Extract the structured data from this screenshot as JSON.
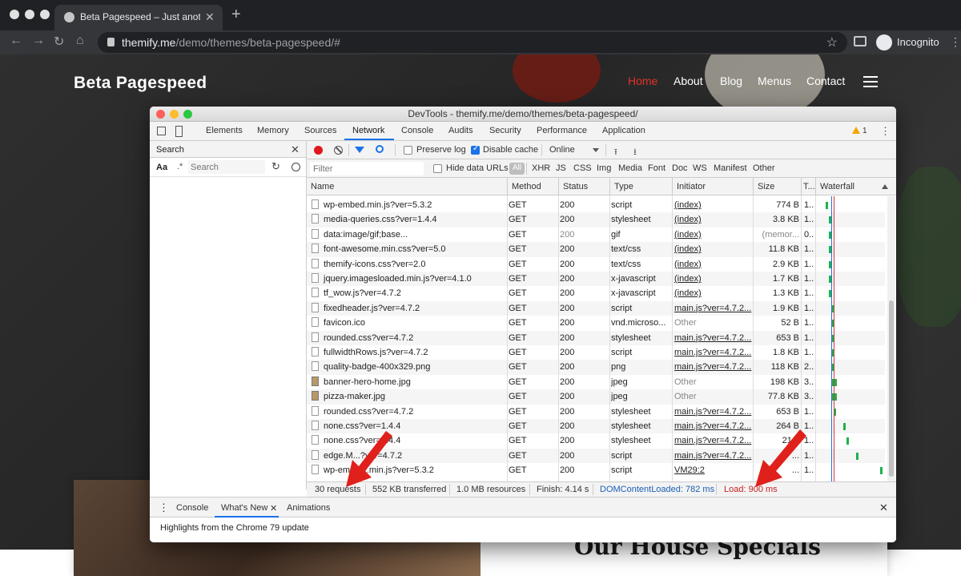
{
  "browser": {
    "tab_title": "Beta Pagespeed – Just another",
    "url_host": "themify.me",
    "url_path": "/demo/themes/beta-pagespeed/#",
    "profile_label": "Incognito"
  },
  "site": {
    "brand": "Beta Pagespeed",
    "nav": [
      "Home",
      "About",
      "Blog",
      "Menus",
      "Contact"
    ],
    "section_heading": "Our House Specials",
    "accent_color": "#e4312b"
  },
  "devtools": {
    "window_title": "DevTools - themify.me/demo/themes/beta-pagespeed/",
    "tabs": [
      "Elements",
      "Memory",
      "Sources",
      "Network",
      "Console",
      "Audits",
      "Security",
      "Performance",
      "Application"
    ],
    "active_tab": "Network",
    "warnings": "1",
    "search": {
      "title": "Search",
      "case_label": "Aa",
      "regex_label": ".*",
      "placeholder": "Search"
    },
    "toolbar": {
      "preserve_log": "Preserve log",
      "disable_cache": "Disable cache",
      "throttle": "Online"
    },
    "filter": {
      "placeholder": "Filter",
      "hide_data_urls": "Hide data URLs",
      "types": [
        "All",
        "XHR",
        "JS",
        "CSS",
        "Img",
        "Media",
        "Font",
        "Doc",
        "WS",
        "Manifest",
        "Other"
      ]
    },
    "columns": [
      "Name",
      "Method",
      "Status",
      "Type",
      "Initiator",
      "Size",
      "T...",
      "Waterfall"
    ],
    "rows": [
      {
        "name": "wp-embed.min.js?ver=5.3.2",
        "method": "GET",
        "status": "200",
        "type": "script",
        "initiator": "(index)",
        "size": "774 B",
        "time": "1...",
        "img": false
      },
      {
        "name": "media-queries.css?ver=1.4.4",
        "method": "GET",
        "status": "200",
        "type": "stylesheet",
        "initiator": "(index)",
        "size": "3.8 KB",
        "time": "1...",
        "img": false
      },
      {
        "name": "data:image/gif;base...",
        "method": "GET",
        "status": "200",
        "type": "gif",
        "initiator": "(index)",
        "size": "(memor...",
        "time": "0...",
        "img": false
      },
      {
        "name": "font-awesome.min.css?ver=5.0",
        "method": "GET",
        "status": "200",
        "type": "text/css",
        "initiator": "(index)",
        "size": "11.8 KB",
        "time": "1...",
        "img": false
      },
      {
        "name": "themify-icons.css?ver=2.0",
        "method": "GET",
        "status": "200",
        "type": "text/css",
        "initiator": "(index)",
        "size": "2.9 KB",
        "time": "1...",
        "img": false
      },
      {
        "name": "jquery.imagesloaded.min.js?ver=4.1.0",
        "method": "GET",
        "status": "200",
        "type": "x-javascript",
        "initiator": "(index)",
        "size": "1.7 KB",
        "time": "1...",
        "img": false
      },
      {
        "name": "tf_wow.js?ver=4.7.2",
        "method": "GET",
        "status": "200",
        "type": "x-javascript",
        "initiator": "(index)",
        "size": "1.3 KB",
        "time": "1...",
        "img": false
      },
      {
        "name": "fixedheader.js?ver=4.7.2",
        "method": "GET",
        "status": "200",
        "type": "script",
        "initiator": "main.js?ver=4.7.2...",
        "size": "1.9 KB",
        "time": "1...",
        "img": false
      },
      {
        "name": "favicon.ico",
        "method": "GET",
        "status": "200",
        "type": "vnd.microso...",
        "initiator": "Other",
        "size": "52 B",
        "time": "1...",
        "img": false
      },
      {
        "name": "rounded.css?ver=4.7.2",
        "method": "GET",
        "status": "200",
        "type": "stylesheet",
        "initiator": "main.js?ver=4.7.2...",
        "size": "653 B",
        "time": "1...",
        "img": false
      },
      {
        "name": "fullwidthRows.js?ver=4.7.2",
        "method": "GET",
        "status": "200",
        "type": "script",
        "initiator": "main.js?ver=4.7.2...",
        "size": "1.8 KB",
        "time": "1...",
        "img": false
      },
      {
        "name": "quality-badge-400x329.png",
        "method": "GET",
        "status": "200",
        "type": "png",
        "initiator": "main.js?ver=4.7.2...",
        "size": "118 KB",
        "time": "2...",
        "img": false
      },
      {
        "name": "banner-hero-home.jpg",
        "method": "GET",
        "status": "200",
        "type": "jpeg",
        "initiator": "Other",
        "size": "198 KB",
        "time": "3...",
        "img": true
      },
      {
        "name": "pizza-maker.jpg",
        "method": "GET",
        "status": "200",
        "type": "jpeg",
        "initiator": "Other",
        "size": "77.8 KB",
        "time": "3...",
        "img": true
      },
      {
        "name": "rounded.css?ver=4.7.2",
        "method": "GET",
        "status": "200",
        "type": "stylesheet",
        "initiator": "main.js?ver=4.7.2...",
        "size": "653 B",
        "time": "1...",
        "img": false
      },
      {
        "name": "none.css?ver=1.4.4",
        "method": "GET",
        "status": "200",
        "type": "stylesheet",
        "initiator": "main.js?ver=4.7.2...",
        "size": "264 B",
        "time": "1...",
        "img": false
      },
      {
        "name": "none.css?ver=1.4.4",
        "method": "GET",
        "status": "200",
        "type": "stylesheet",
        "initiator": "main.js?ver=4.7.2...",
        "size": "21...",
        "time": "1...",
        "img": false
      },
      {
        "name": "edge.M...?ver=4.7.2",
        "method": "GET",
        "status": "200",
        "type": "script",
        "initiator": "main.js?ver=4.7.2...",
        "size": "...",
        "time": "1...",
        "img": false
      },
      {
        "name": "wp-em...se.min.js?ver=5.3.2",
        "method": "GET",
        "status": "200",
        "type": "script",
        "initiator": "VM29:2",
        "size": "...",
        "time": "1...",
        "img": false
      }
    ],
    "summary": {
      "requests": "30 requests",
      "transferred": "552 KB transferred",
      "resources": "1.0 MB resources",
      "finish": "Finish: 4.14 s",
      "dcl": "DOMContentLoaded: 782 ms",
      "load": "Load: 900 ms"
    },
    "drawer": {
      "tabs": [
        "Console",
        "What's New",
        "Animations"
      ],
      "active": "What's New",
      "message": "Highlights from the Chrome 79 update"
    }
  }
}
